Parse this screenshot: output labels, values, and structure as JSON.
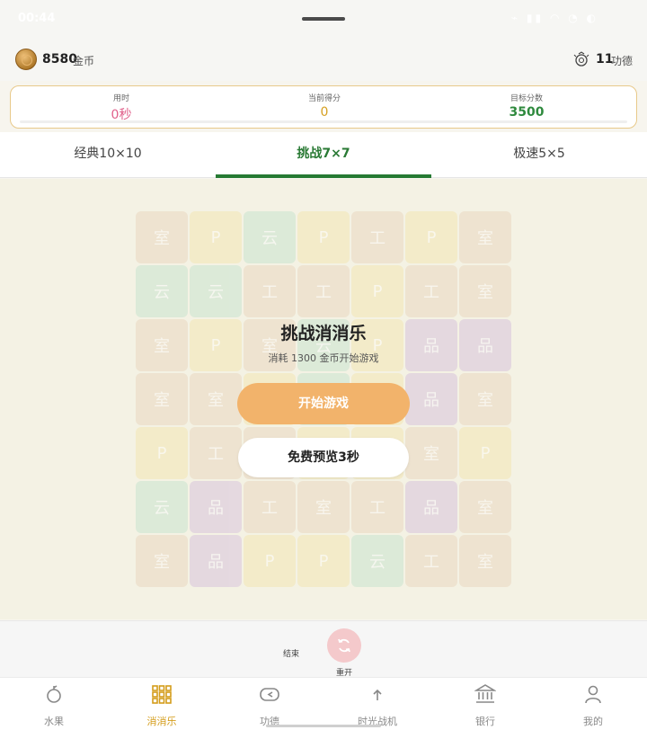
{
  "status": {
    "time": "00:44",
    "icons": "⌁ ▮▮ ◠ ◔ ◐"
  },
  "header": {
    "coins_value": "8580",
    "coins_unit": "金币",
    "merit_value": "11",
    "merit_unit": "功德"
  },
  "score": {
    "time_label": "用时",
    "time_value": "0秒",
    "current_label": "当前得分",
    "current_value": "0",
    "target_label": "目标分数",
    "target_value": "3500"
  },
  "tabs": [
    "经典10×10",
    "挑战7×7",
    "极速5×5"
  ],
  "board": {
    "tiles": [
      [
        "室",
        "P",
        "云",
        "P",
        "工",
        "P",
        "室"
      ],
      [
        "云",
        "云",
        "工",
        "工",
        "P",
        "工",
        "室"
      ],
      [
        "室",
        "P",
        "室",
        "云",
        "P",
        "品",
        "品"
      ],
      [
        "室",
        "室",
        "P",
        "云",
        "P",
        "品",
        "室"
      ],
      [
        "P",
        "工",
        "工",
        "P",
        "P",
        "室",
        "P"
      ],
      [
        "云",
        "品",
        "工",
        "室",
        "工",
        "品",
        "室"
      ],
      [
        "室",
        "品",
        "P",
        "P",
        "云",
        "工",
        "室"
      ]
    ],
    "colors": [
      [
        "beige",
        "yellow",
        "green",
        "yellow",
        "beige",
        "yellow",
        "beige"
      ],
      [
        "green",
        "green",
        "beige",
        "beige",
        "yellow",
        "beige",
        "beige"
      ],
      [
        "beige",
        "yellow",
        "beige",
        "green",
        "yellow",
        "purple",
        "purple"
      ],
      [
        "beige",
        "beige",
        "yellow",
        "green",
        "yellow",
        "purple",
        "beige"
      ],
      [
        "yellow",
        "beige",
        "beige",
        "yellow",
        "yellow",
        "beige",
        "yellow"
      ],
      [
        "green",
        "purple",
        "beige",
        "beige",
        "beige",
        "purple",
        "beige"
      ],
      [
        "beige",
        "purple",
        "yellow",
        "yellow",
        "green",
        "beige",
        "beige"
      ]
    ]
  },
  "overlay": {
    "title": "挑战消消乐",
    "subtitle": "消耗 1300 金币开始游戏",
    "start_button": "开始游戏",
    "preview_button": "免费预览3秒"
  },
  "controls": {
    "end_label": "结束",
    "restart_label": "重开"
  },
  "nav": [
    {
      "label": "水果",
      "icon": "fruit-icon"
    },
    {
      "label": "消消乐",
      "icon": "grid-icon"
    },
    {
      "label": "功德",
      "icon": "fish-icon"
    },
    {
      "label": "时光战机",
      "icon": "plane-icon"
    },
    {
      "label": "银行",
      "icon": "bank-icon"
    },
    {
      "label": "我的",
      "icon": "user-icon"
    }
  ],
  "colors": {
    "accent_green": "#267a33",
    "accent_gold": "#d49c1a",
    "start_button": "#f2b36b",
    "time_pink": "#e0608a"
  }
}
